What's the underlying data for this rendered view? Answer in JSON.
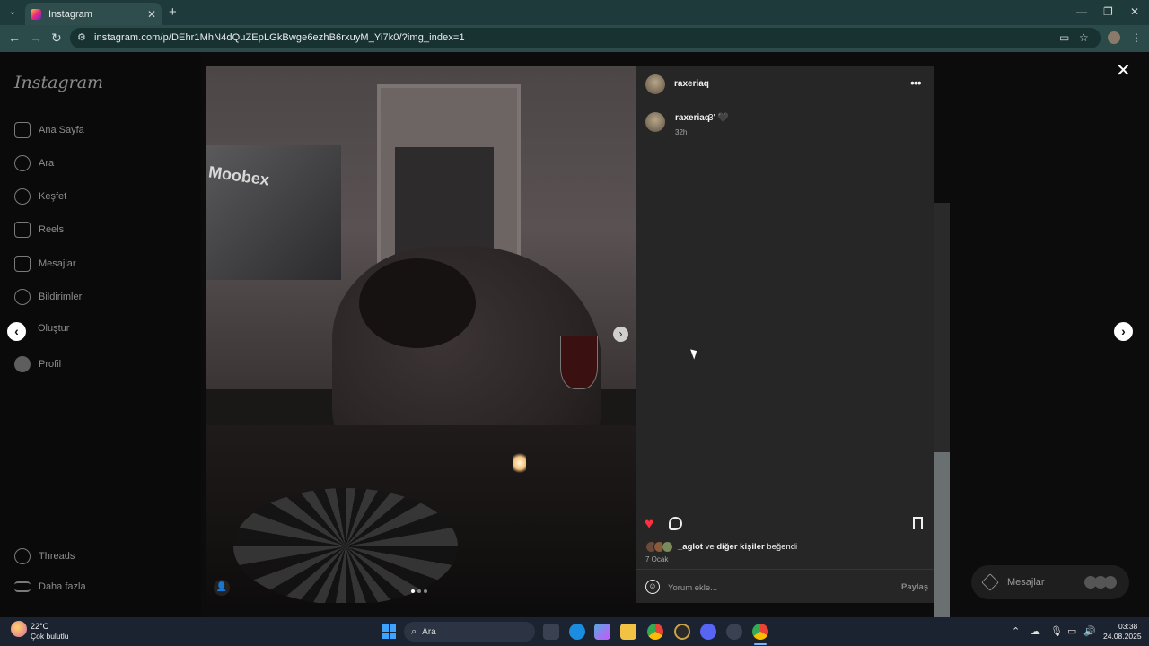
{
  "browser": {
    "tab_title": "Instagram",
    "url": "instagram.com/p/DEhr1MhN4dQuZEpLGkBwge6ezhB6rxuyM_Yi7k0/?img_index=1"
  },
  "sidebar": {
    "logo": "Instagram",
    "items": [
      {
        "label": "Ana Sayfa",
        "icon": "home-icon"
      },
      {
        "label": "Ara",
        "icon": "search-icon"
      },
      {
        "label": "Keşfet",
        "icon": "compass-icon"
      },
      {
        "label": "Reels",
        "icon": "reels-icon"
      },
      {
        "label": "Mesajlar",
        "icon": "messenger-icon"
      },
      {
        "label": "Bildirimler",
        "icon": "heart-icon"
      },
      {
        "label": "Oluştur",
        "icon": "plus-icon"
      },
      {
        "label": "Profil",
        "icon": "avatar-icon"
      }
    ],
    "bottom_items": [
      {
        "label": "Threads",
        "icon": "threads-icon"
      },
      {
        "label": "Daha fazla",
        "icon": "menu-icon"
      }
    ]
  },
  "post": {
    "photo_tv_text": "Moobex",
    "username": "raxeriaq",
    "caption_user": "raxeriaq",
    "caption_text": "3' 🖤",
    "caption_time": "32h",
    "likes_user": "_aglot",
    "likes_connector": "ve",
    "likes_others": "diğer kişiler",
    "likes_suffix": "beğendi",
    "date": "7 Ocak",
    "comment_placeholder": "Yorum ekle...",
    "share_label": "Paylaş",
    "liked": true,
    "like_color": "#ff3040",
    "carousel_index": 1,
    "carousel_count": 3
  },
  "messages_widget": {
    "label": "Mesajlar"
  },
  "taskbar": {
    "weather_temp": "22°C",
    "weather_desc": "Çok bulutlu",
    "search_label": "Ara",
    "time": "03:38",
    "date": "24.08.2025"
  }
}
